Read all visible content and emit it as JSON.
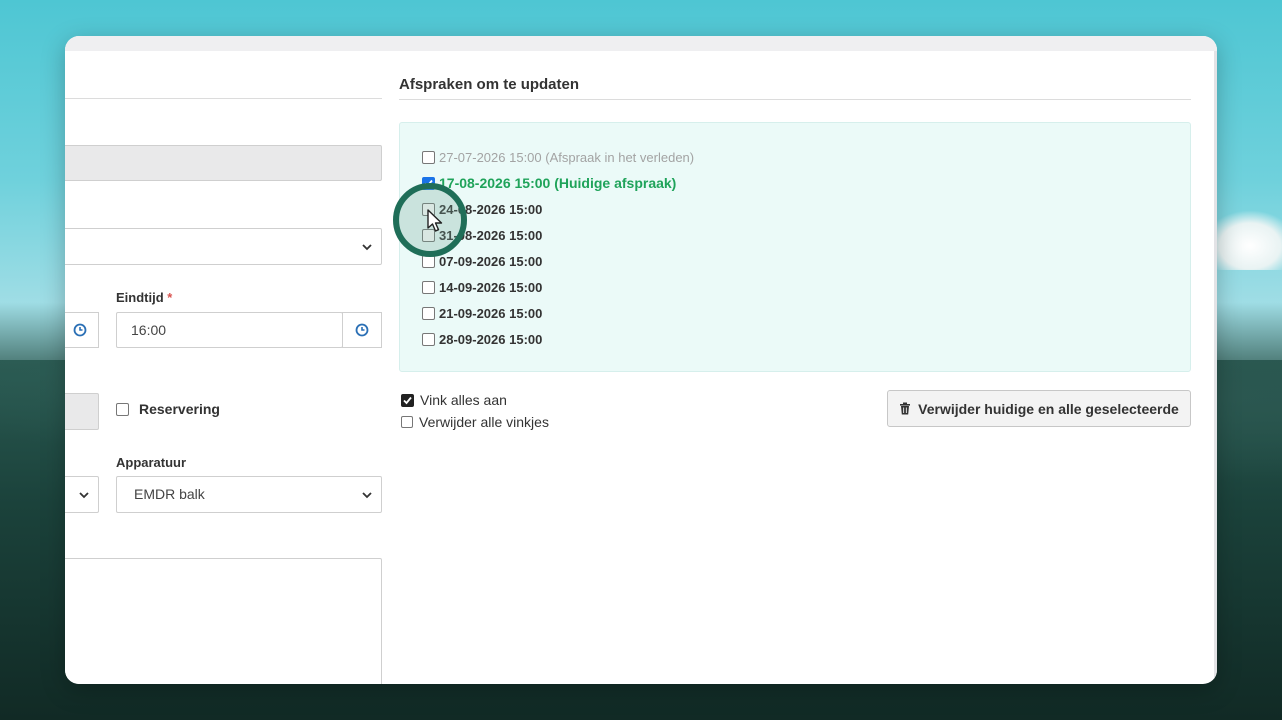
{
  "appointments_section": {
    "title": "Afspraken om te updaten",
    "items": [
      {
        "label": "27-07-2026 15:00 (Afspraak in het verleden)",
        "checked": false,
        "state": "past"
      },
      {
        "label": "17-08-2026 15:00 (Huidige afspraak)",
        "checked": true,
        "state": "current"
      },
      {
        "label": "24-08-2026 15:00",
        "checked": false,
        "state": "future"
      },
      {
        "label": "31-08-2026 15:00",
        "checked": false,
        "state": "future"
      },
      {
        "label": "07-09-2026 15:00",
        "checked": false,
        "state": "future"
      },
      {
        "label": "14-09-2026 15:00",
        "checked": false,
        "state": "future"
      },
      {
        "label": "21-09-2026 15:00",
        "checked": false,
        "state": "future"
      },
      {
        "label": "28-09-2026 15:00",
        "checked": false,
        "state": "future"
      }
    ],
    "check_all_label": "Vink alles aan",
    "uncheck_all_label": "Verwijder alle vinkjes",
    "delete_button_label": "Verwijder huidige en alle geselecteerde"
  },
  "form": {
    "end_time_label": "Eindtijd",
    "required_marker": "*",
    "end_time_value": "16:00",
    "reservation_label": "Reservering",
    "equipment_label": "Apparatuur",
    "equipment_value": "EMDR balk"
  },
  "colors": {
    "current_appointment": "#1fa35a",
    "panel_background": "#ebfaf8",
    "checkbox_checked": "#1a73e8",
    "required": "#d9534f",
    "cursor_ring": "#1f6e58"
  }
}
